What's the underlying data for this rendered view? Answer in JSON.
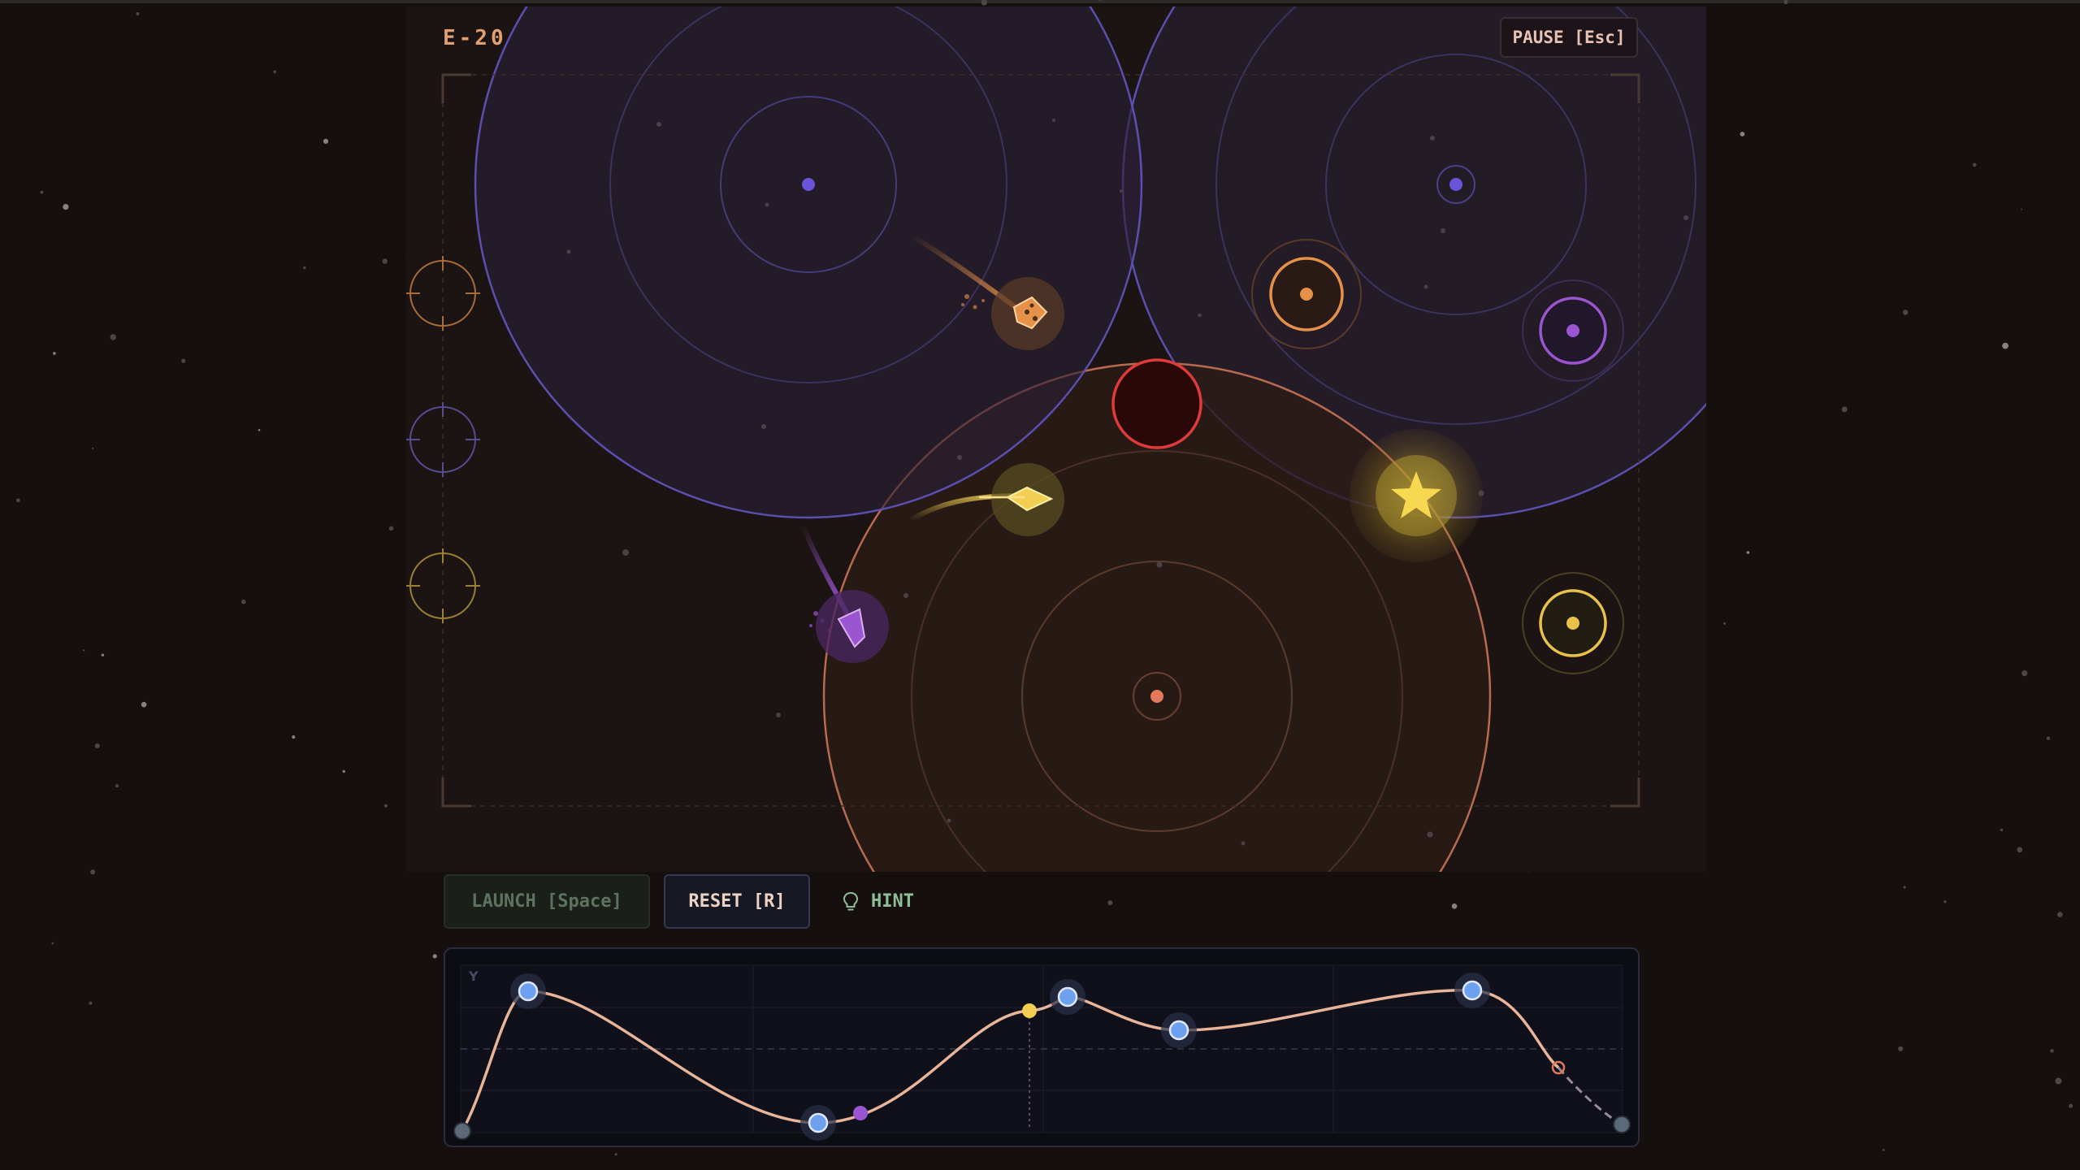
{
  "hud": {
    "level_label": "E-20",
    "pause_label": "PAUSE [Esc]"
  },
  "controls": {
    "launch_label": "LAUNCH [Space]",
    "reset_label": "RESET [R]",
    "hint_label": "HINT",
    "hint_icon": "lightbulb-icon"
  },
  "graph": {
    "axis_label": "Y"
  },
  "colors": {
    "background": "#150f0d",
    "playfield": "#1b1412",
    "violet_orbit": "#5b4fb0",
    "orange_orbit": "#c7765a",
    "black_hole": "#e03a3a",
    "star": "#f8d850",
    "curve": "#e8b49a",
    "node": "#6ea0f0"
  },
  "game": {
    "planets": [
      {
        "name": "violet-planet-left",
        "color": "#6a55d8"
      },
      {
        "name": "violet-planet-right",
        "color": "#6a55d8"
      },
      {
        "name": "orange-planet",
        "color": "#e07a5a"
      }
    ],
    "targets": [
      {
        "name": "target-orange",
        "color": "#e5914a"
      },
      {
        "name": "target-violet",
        "color": "#9b55d0"
      },
      {
        "name": "target-yellow",
        "color": "#e8c24a"
      }
    ],
    "ships": [
      {
        "name": "ship-orange",
        "icon": "dice-ship-icon",
        "color": "#e5914a"
      },
      {
        "name": "ship-yellow",
        "icon": "dart-ship-icon",
        "color": "#f2cf52"
      },
      {
        "name": "ship-violet",
        "icon": "crystal-ship-icon",
        "color": "#9b55d0"
      }
    ],
    "launchers": [
      {
        "name": "launcher-orange",
        "color": "#d08a3a"
      },
      {
        "name": "launcher-violet",
        "color": "#6a5ab0"
      },
      {
        "name": "launcher-yellow",
        "color": "#c8a640"
      }
    ]
  }
}
